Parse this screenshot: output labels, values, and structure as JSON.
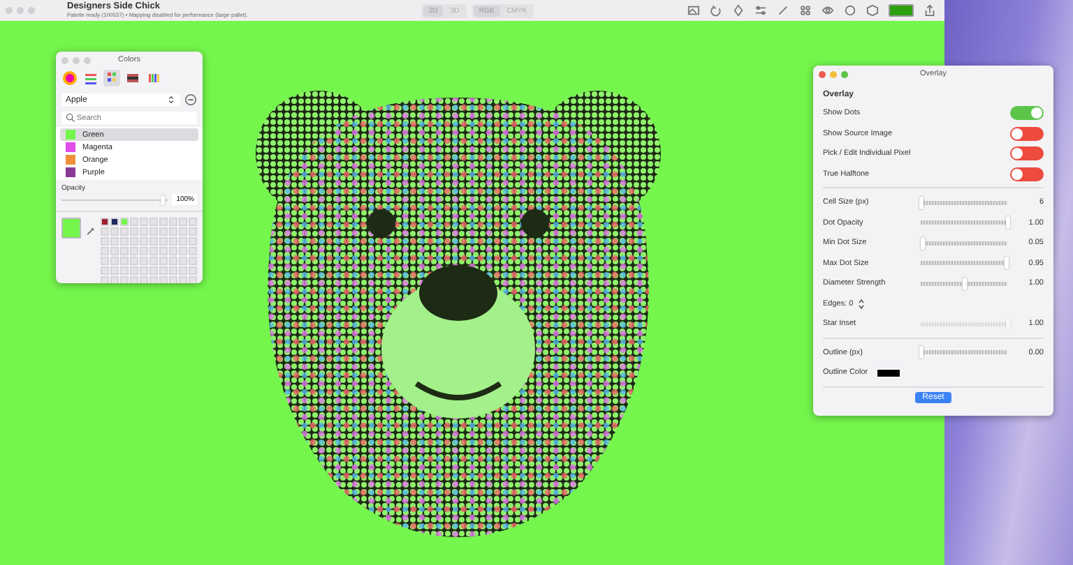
{
  "window": {
    "title": "Designers Side Chick",
    "subtitle": "Palette ready (100537)  •  Mapping disabled for performance (large pallet)."
  },
  "view_modes": [
    {
      "label": "2D",
      "selected": true
    },
    {
      "label": "3D",
      "selected": false
    }
  ],
  "color_modes": [
    {
      "label": "RGB",
      "selected": true
    },
    {
      "label": "CMYK",
      "selected": false
    }
  ],
  "toolbar": {
    "tools": [
      {
        "kind": "image"
      },
      {
        "kind": "rotate"
      },
      {
        "kind": "bucket"
      },
      {
        "kind": "sliders"
      },
      {
        "kind": "pencil"
      },
      {
        "kind": "grid"
      },
      {
        "kind": "eye"
      },
      {
        "kind": "circle"
      },
      {
        "kind": "hexagon"
      }
    ],
    "color_well": {
      "color": "#2fa012"
    }
  },
  "canvas": {
    "color": "#74f64c"
  },
  "colors_panel": {
    "title": "Colors",
    "tabs": [
      {
        "kind": "wheel",
        "selected": false
      },
      {
        "kind": "sliders",
        "selected": false
      },
      {
        "kind": "palettes",
        "selected": true
      },
      {
        "kind": "image",
        "selected": false
      },
      {
        "kind": "pencils",
        "selected": false
      }
    ],
    "palette": "Apple",
    "search": {
      "placeholder": "Search"
    },
    "items": [
      {
        "name": "Green",
        "color": "#74f54c",
        "selected": true
      },
      {
        "name": "Magenta",
        "color": "#e24ce8",
        "selected": false
      },
      {
        "name": "Orange",
        "color": "#f0903a",
        "selected": false
      },
      {
        "name": "Purple",
        "color": "#8a3a96",
        "selected": false
      }
    ],
    "opacity": {
      "label": "Opacity",
      "level": 0.95,
      "reading": "100%"
    },
    "current_color": {
      "color": "#74f54c"
    },
    "swatches": [
      {
        "color": "#a01c2c"
      },
      {
        "color": "#1c2a5c"
      },
      {
        "color": "#74f54c"
      }
    ]
  },
  "overlay_panel": {
    "title": "Overlay",
    "heading": "Overlay",
    "groups": [
      [
        {
          "kind": "toggle",
          "label": "Show Dots",
          "on": true
        },
        {
          "kind": "toggle",
          "label": "Show Source Image",
          "on": false
        },
        {
          "kind": "toggle",
          "label": "Pick / Edit Individual Pixel",
          "on": false
        },
        {
          "kind": "toggle",
          "label": "True Halftone",
          "on": false
        }
      ],
      [
        {
          "kind": "slider",
          "label": "Cell Size (px)",
          "level": 0.0,
          "reading": "6",
          "disabled": false
        },
        {
          "kind": "slider",
          "label": "Dot Opacity",
          "level": 1.0,
          "reading": "1.00",
          "disabled": false
        },
        {
          "kind": "slider",
          "label": "Min Dot Size",
          "level": 0.02,
          "reading": "0.05",
          "disabled": false
        },
        {
          "kind": "slider",
          "label": "Max Dot Size",
          "level": 0.98,
          "reading": "0.95",
          "disabled": false
        },
        {
          "kind": "slider",
          "label": "Diameter Strength",
          "level": 0.5,
          "reading": "1.00",
          "disabled": false
        },
        {
          "kind": "stepper",
          "label": "Edges: 0"
        },
        {
          "kind": "slider",
          "label": "Star Inset",
          "level": 1.0,
          "reading": "1.00",
          "disabled": true
        }
      ],
      [
        {
          "kind": "slider",
          "label": "Outline (px)",
          "level": 0.0,
          "reading": "0.00",
          "disabled": false
        },
        {
          "kind": "color",
          "label": "Outline Color",
          "color": "#000000"
        }
      ]
    ],
    "button": "Reset"
  }
}
